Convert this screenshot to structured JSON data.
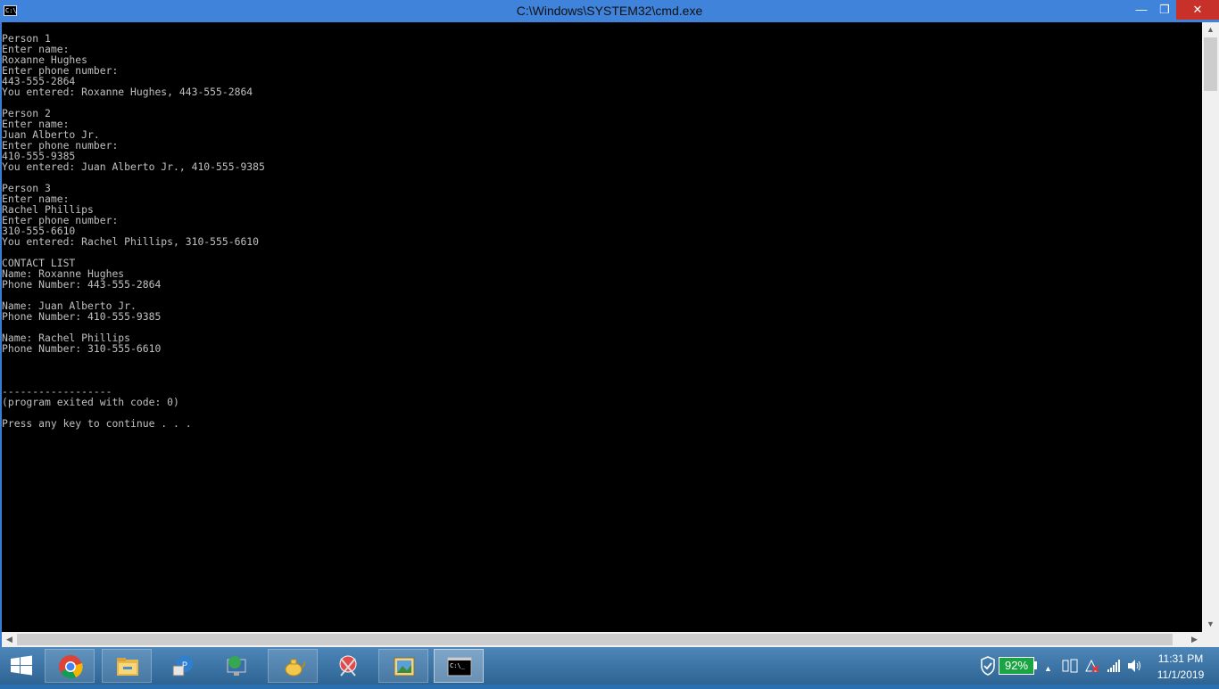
{
  "window": {
    "title": "C:\\Windows\\SYSTEM32\\cmd.exe",
    "icon_label": "C:\\",
    "minimize_glyph": "—",
    "maximize_glyph": "❐",
    "close_glyph": "✕"
  },
  "console": {
    "lines": [
      "Person 1",
      "Enter name:",
      "Roxanne Hughes",
      "Enter phone number:",
      "443-555-2864",
      "You entered: Roxanne Hughes, 443-555-2864",
      "",
      "Person 2",
      "Enter name:",
      "Juan Alberto Jr.",
      "Enter phone number:",
      "410-555-9385",
      "You entered: Juan Alberto Jr., 410-555-9385",
      "",
      "Person 3",
      "Enter name:",
      "Rachel Phillips",
      "Enter phone number:",
      "310-555-6610",
      "You entered: Rachel Phillips, 310-555-6610",
      "",
      "CONTACT LIST",
      "Name: Roxanne Hughes",
      "Phone Number: 443-555-2864",
      "",
      "Name: Juan Alberto Jr.",
      "Phone Number: 410-555-9385",
      "",
      "Name: Rachel Phillips",
      "Phone Number: 310-555-6610",
      "",
      "",
      "",
      "------------------",
      "(program exited with code: 0)",
      "",
      "Press any key to continue . . ."
    ],
    "background_color": "#000000",
    "text_color": "#c0c0c0"
  },
  "scrollbars": {
    "up": "▲",
    "down": "▼",
    "left": "◀",
    "right": "▶"
  },
  "taskbar": {
    "apps": [
      {
        "name": "chrome-icon"
      },
      {
        "name": "file-explorer-icon"
      },
      {
        "name": "network-app-icon"
      },
      {
        "name": "monitor-globe-icon"
      },
      {
        "name": "teapot-icon"
      },
      {
        "name": "snipping-tool-icon"
      },
      {
        "name": "photo-viewer-icon"
      },
      {
        "name": "command-prompt-icon"
      }
    ],
    "battery_percent": "92%",
    "tray_chevron": "▲",
    "clock_time": "11:31 PM",
    "clock_date": "11/1/2019"
  }
}
